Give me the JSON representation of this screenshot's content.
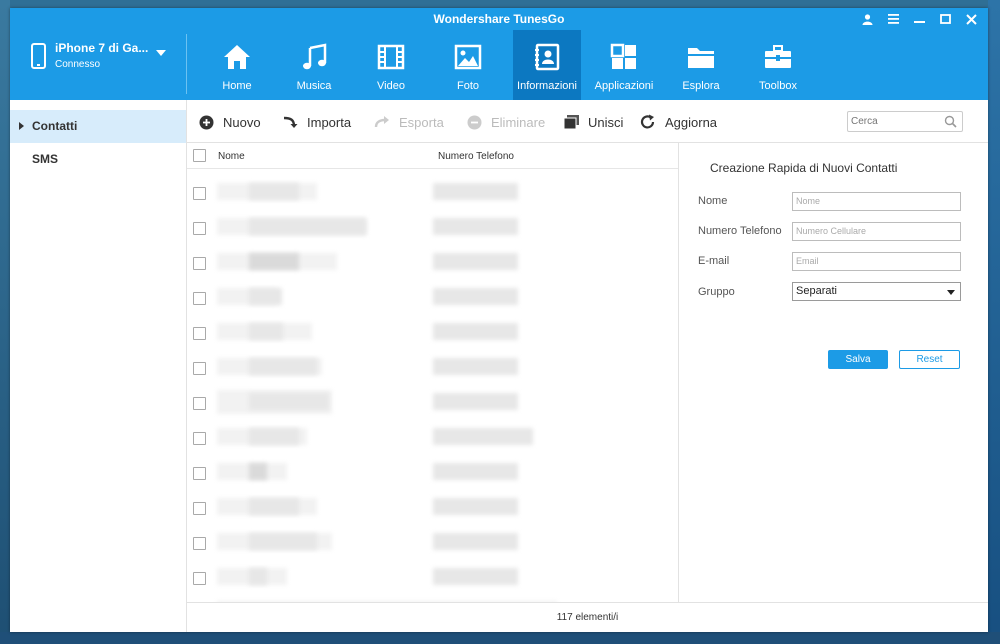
{
  "app_title": "Wondershare TunesGo",
  "device": {
    "name": "iPhone 7 di Ga...",
    "status": "Connesso"
  },
  "nav": [
    {
      "label": "Home",
      "icon": "home-icon"
    },
    {
      "label": "Musica",
      "icon": "music-icon"
    },
    {
      "label": "Video",
      "icon": "video-icon"
    },
    {
      "label": "Foto",
      "icon": "photo-icon"
    },
    {
      "label": "Informazioni",
      "icon": "contacts-icon",
      "active": true
    },
    {
      "label": "Applicazioni",
      "icon": "apps-icon"
    },
    {
      "label": "Esplora",
      "icon": "folder-icon"
    },
    {
      "label": "Toolbox",
      "icon": "toolbox-icon"
    }
  ],
  "sidebar": [
    {
      "label": "Contatti",
      "active": true
    },
    {
      "label": "SMS"
    }
  ],
  "toolbar": {
    "nuovo": "Nuovo",
    "importa": "Importa",
    "esporta": "Esporta",
    "eliminare": "Eliminare",
    "unisci": "Unisci",
    "aggiorna": "Aggiorna",
    "search_placeholder": "Cerca"
  },
  "table": {
    "col_name": "Nome",
    "col_phone": "Numero Telefono"
  },
  "footer": {
    "count": "117 elementi/i"
  },
  "quick_add": {
    "title": "Creazione Rapida di Nuovi Contatti",
    "name_label": "Nome",
    "name_placeholder": "Nome",
    "phone_label": "Numero Telefono",
    "phone_placeholder": "Numero Cellulare",
    "email_label": "E-mail",
    "email_placeholder": "Email",
    "group_label": "Gruppo",
    "group_value": "Separati",
    "save": "Salva",
    "reset": "Reset"
  },
  "colors": {
    "accent": "#1c9be6",
    "active_tab": "#0c78c1",
    "sidebar_active": "#d7ecfb"
  }
}
